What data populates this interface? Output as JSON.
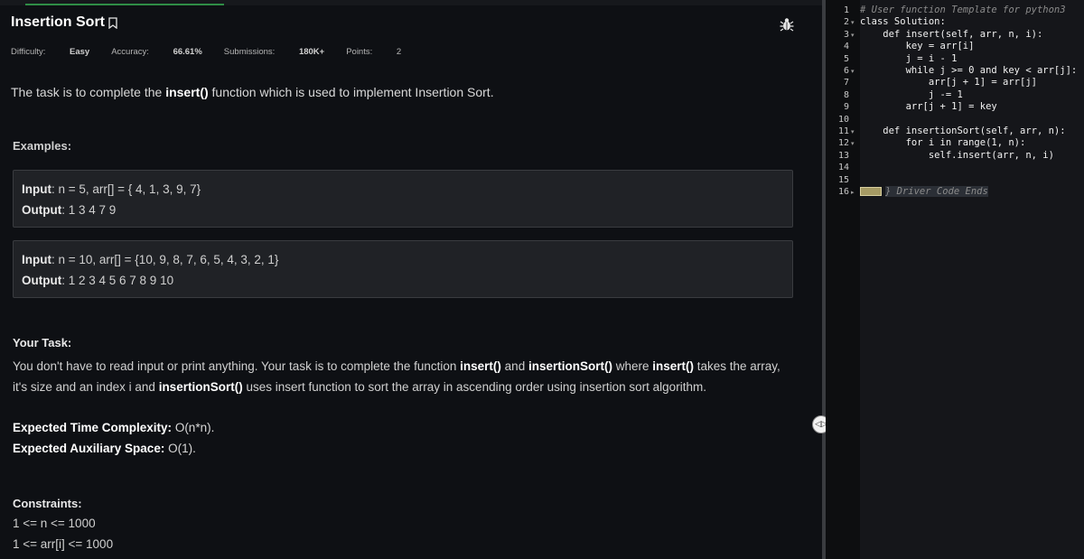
{
  "problem": {
    "title": "Insertion Sort",
    "meta": {
      "difficulty_label": "Difficulty:",
      "difficulty_value": "Easy",
      "accuracy_label": "Accuracy:",
      "accuracy_value": "66.61%",
      "submissions_label": "Submissions:",
      "submissions_value": "180K+",
      "points_label": "Points:",
      "points_value": "2"
    },
    "description": {
      "before": "The task is to complete the ",
      "fn": "insert()",
      "after": " function which is used to implement Insertion Sort."
    },
    "examples_heading": "Examples:",
    "examples": [
      {
        "input_label": "Input",
        "input_text": ": n = 5, arr[] = { 4, 1, 3, 9, 7}",
        "output_label": "Output",
        "output_text": ": 1 3 4 7 9"
      },
      {
        "input_label": "Input",
        "input_text": ": n = 10, arr[] = {10, 9, 8, 7, 6, 5, 4, 3, 2, 1}",
        "output_label": "Output",
        "output_text": ": 1 2 3 4 5 6 7 8 9 10"
      }
    ],
    "task_heading": "Your Task:",
    "task": {
      "p1": "You don't have to read input or print anything. Your task is to complete the function ",
      "b1": "insert()",
      "p2": " and ",
      "b2": "insertionSort()",
      "p3": " where ",
      "b3": "insert()",
      "p4": " takes the array, it's size and an index i and ",
      "b4": "insertionSort()",
      "p5": " uses insert function to sort the array in ascending order using insertion sort algorithm."
    },
    "time_label": "Expected Time Complexity:",
    "time_value": " O(n*n).",
    "space_label": "Expected Auxiliary Space:",
    "space_value": " O(1).",
    "constraints_heading": "Constraints:",
    "constraints": [
      "1 <= n <= 1000",
      "1 <= arr[i] <= 1000"
    ]
  },
  "divider": {
    "handle_glyph": "◁▷"
  },
  "editor": {
    "line_numbers": [
      "1",
      "2",
      "3",
      "4",
      "5",
      "6",
      "7",
      "8",
      "9",
      "10",
      "11",
      "12",
      "13",
      "14",
      "15",
      "16"
    ],
    "folded_lines": [
      "2",
      "3",
      "6",
      "11",
      "12",
      "16"
    ],
    "lines": [
      "# User function Template for python3",
      "class Solution:",
      "    def insert(self, arr, n, i):",
      "        key = arr[i]",
      "        j = i - 1",
      "        while j >= 0 and key < arr[j]:",
      "            arr[j + 1] = arr[j]",
      "            j -= 1",
      "        arr[j + 1] = key",
      "",
      "    def insertionSort(self, arr, n):",
      "        for i in range(1, n):",
      "            self.insert(arr, n, i)",
      "",
      "",
      "} Driver Code Ends"
    ]
  },
  "colors": {
    "background": "#0e1014",
    "accent": "#2f8d46",
    "example_box": "#202226",
    "editor_bg": "#15161a"
  },
  "icons": [
    "bookmark-icon",
    "bug-icon",
    "drag-handle-icon",
    "fold-arrow-icon"
  ]
}
